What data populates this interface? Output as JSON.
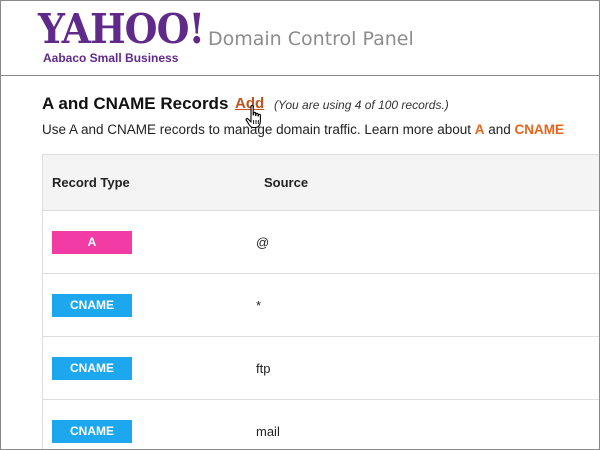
{
  "header": {
    "logo_text": "YAHOO!",
    "logo_subtitle": "Aabaco Small Business",
    "app_title": "Domain Control Panel"
  },
  "section": {
    "title": "A and CNAME Records",
    "add_label": "Add",
    "usage_note": "(You are using 4 of 100 records.)",
    "description_prefix": "Use A and CNAME records to manage domain traffic. Learn more about ",
    "link_a": "A",
    "description_and": " and ",
    "link_cname": "CNAME"
  },
  "table": {
    "columns": [
      "Record Type",
      "Source"
    ],
    "rows": [
      {
        "type": "A",
        "source": "@"
      },
      {
        "type": "CNAME",
        "source": "*"
      },
      {
        "type": "CNAME",
        "source": "ftp"
      },
      {
        "type": "CNAME",
        "source": "mail"
      }
    ]
  },
  "colors": {
    "brand_purple": "#5f2a8a",
    "link_orange": "#e8641b",
    "badge_a": "#f23ba5",
    "badge_cname": "#1ca7ef"
  },
  "icons": {
    "cursor": "hand-pointer-icon"
  }
}
